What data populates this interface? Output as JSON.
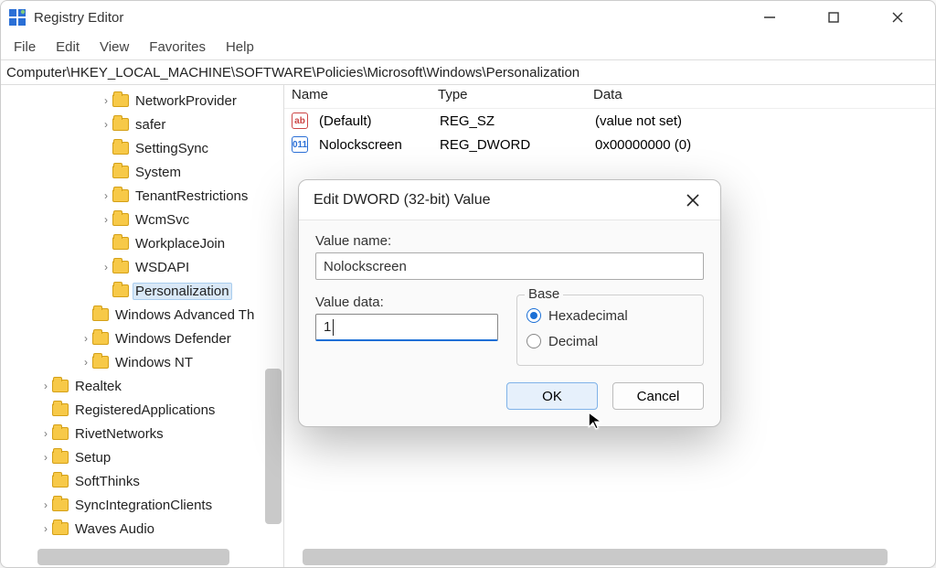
{
  "app": {
    "title": "Registry Editor"
  },
  "menubar": [
    "File",
    "Edit",
    "View",
    "Favorites",
    "Help"
  ],
  "address": "Computer\\HKEY_LOCAL_MACHINE\\SOFTWARE\\Policies\\Microsoft\\Windows\\Personalization",
  "tree": [
    {
      "depth": 4,
      "expander": "right",
      "label": "NetworkProvider"
    },
    {
      "depth": 4,
      "expander": "right",
      "label": "safer"
    },
    {
      "depth": 4,
      "expander": "none",
      "label": "SettingSync"
    },
    {
      "depth": 4,
      "expander": "none",
      "label": "System"
    },
    {
      "depth": 4,
      "expander": "right",
      "label": "TenantRestrictions"
    },
    {
      "depth": 4,
      "expander": "right",
      "label": "WcmSvc"
    },
    {
      "depth": 4,
      "expander": "none",
      "label": "WorkplaceJoin"
    },
    {
      "depth": 4,
      "expander": "right",
      "label": "WSDAPI"
    },
    {
      "depth": 4,
      "expander": "none",
      "label": "Personalization",
      "selected": true
    },
    {
      "depth": 3,
      "expander": "none",
      "label": "Windows Advanced Th"
    },
    {
      "depth": 3,
      "expander": "right",
      "label": "Windows Defender"
    },
    {
      "depth": 3,
      "expander": "right",
      "label": "Windows NT"
    },
    {
      "depth": 1,
      "expander": "right",
      "label": "Realtek"
    },
    {
      "depth": 1,
      "expander": "none",
      "label": "RegisteredApplications"
    },
    {
      "depth": 1,
      "expander": "right",
      "label": "RivetNetworks"
    },
    {
      "depth": 1,
      "expander": "right",
      "label": "Setup"
    },
    {
      "depth": 1,
      "expander": "none",
      "label": "SoftThinks"
    },
    {
      "depth": 1,
      "expander": "right",
      "label": "SyncIntegrationClients"
    },
    {
      "depth": 1,
      "expander": "right",
      "label": "Waves Audio"
    }
  ],
  "columns": {
    "name": "Name",
    "type": "Type",
    "data": "Data"
  },
  "values": [
    {
      "icon": "sz",
      "name": "(Default)",
      "type": "REG_SZ",
      "data": "(value not set)"
    },
    {
      "icon": "dword",
      "name": "Nolockscreen",
      "type": "REG_DWORD",
      "data": "0x00000000 (0)"
    }
  ],
  "dialog": {
    "title": "Edit DWORD (32-bit) Value",
    "value_name_label": "Value name:",
    "value_name": "Nolockscreen",
    "value_data_label": "Value data:",
    "value_data": "1",
    "base_label": "Base",
    "radio_hex": "Hexadecimal",
    "radio_dec": "Decimal",
    "base_selected": "hex",
    "ok": "OK",
    "cancel": "Cancel"
  }
}
